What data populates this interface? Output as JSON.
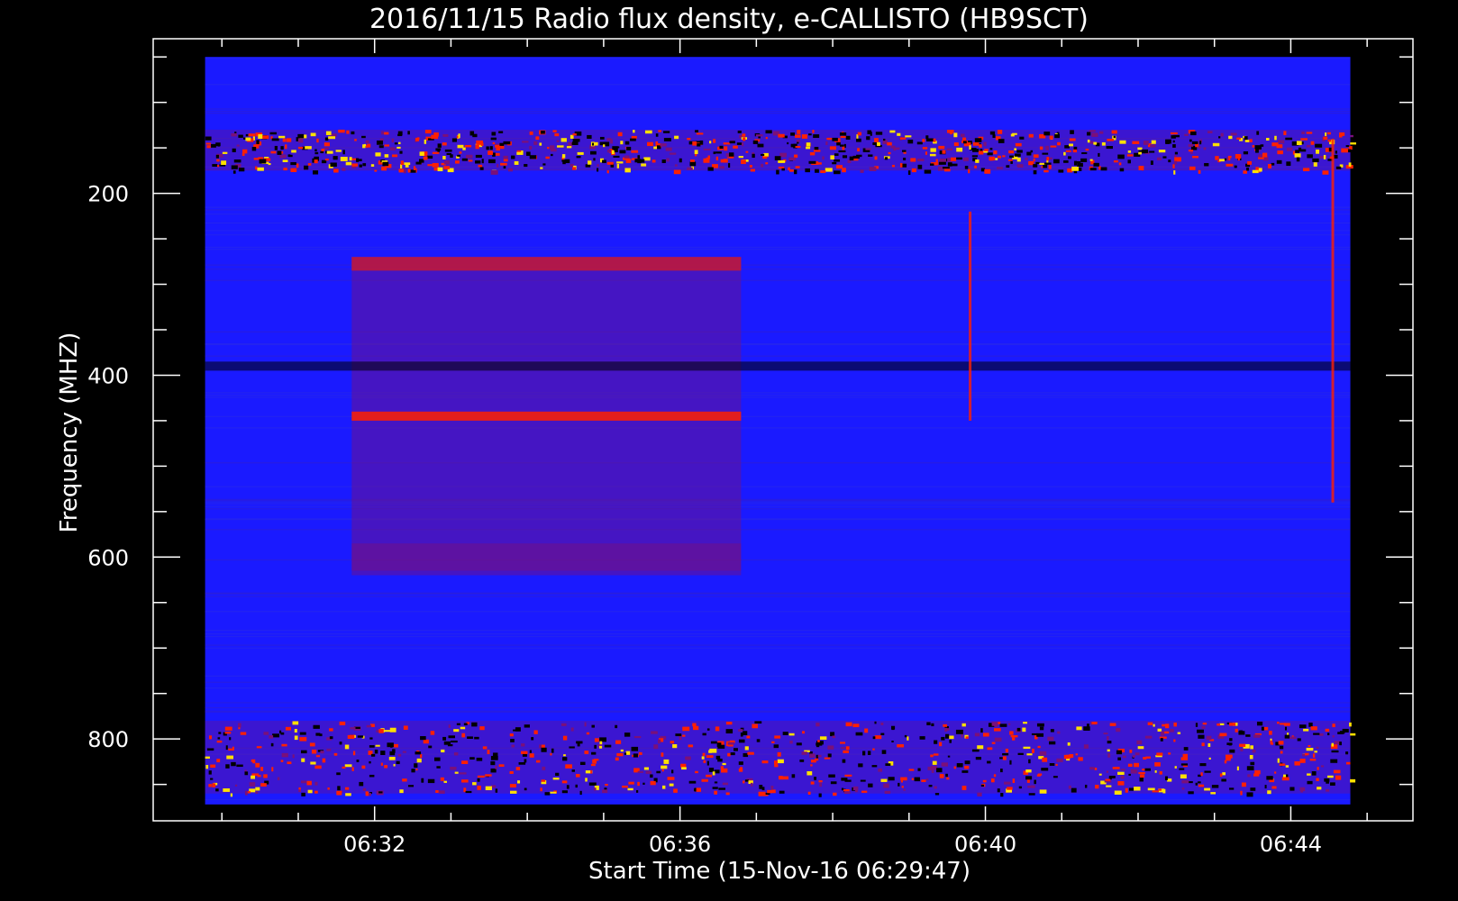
{
  "chart_data": {
    "type": "heatmap",
    "title": "2016/11/15  Radio flux density, e-CALLISTO (HB9SCT)",
    "xlabel": "Start Time (15-Nov-16 06:29:47)",
    "ylabel": "Frequency (MHZ)",
    "x_ticks": [
      "06:32",
      "06:36",
      "06:40",
      "06:44"
    ],
    "x_tick_minutes": [
      32,
      36,
      40,
      44
    ],
    "x_range_minutes": [
      29.1,
      45.6
    ],
    "y_ticks": [
      200,
      400,
      600,
      800
    ],
    "y_range": [
      30,
      890
    ],
    "y_inverted": true,
    "data_time_range_minutes": [
      29.78,
      44.78
    ],
    "data_freq_range": [
      50,
      872
    ],
    "colormap": {
      "background": "#1a1aff",
      "elevated": "#7a107a",
      "strong": "#ff2000",
      "peak": "#ffe000",
      "low": "#000000"
    },
    "bands": [
      {
        "f0": 130,
        "f1": 175,
        "level": "interference"
      },
      {
        "f0": 270,
        "f1": 285,
        "t0": 31.7,
        "t1": 36.8,
        "level": "strong"
      },
      {
        "f0": 270,
        "f1": 620,
        "t0": 31.7,
        "t1": 36.8,
        "level": "elevated"
      },
      {
        "f0": 385,
        "f1": 395,
        "level": "low"
      },
      {
        "f0": 440,
        "f1": 450,
        "t0": 31.7,
        "t1": 36.8,
        "level": "strong"
      },
      {
        "f0": 585,
        "f1": 615,
        "t0": 31.7,
        "t1": 36.8,
        "level": "elevated"
      },
      {
        "f0": 780,
        "f1": 860,
        "level": "interference"
      }
    ],
    "bursts": [
      {
        "t": 39.8,
        "f0": 220,
        "f1": 450
      },
      {
        "t": 44.55,
        "f0": 140,
        "f1": 540
      }
    ]
  }
}
